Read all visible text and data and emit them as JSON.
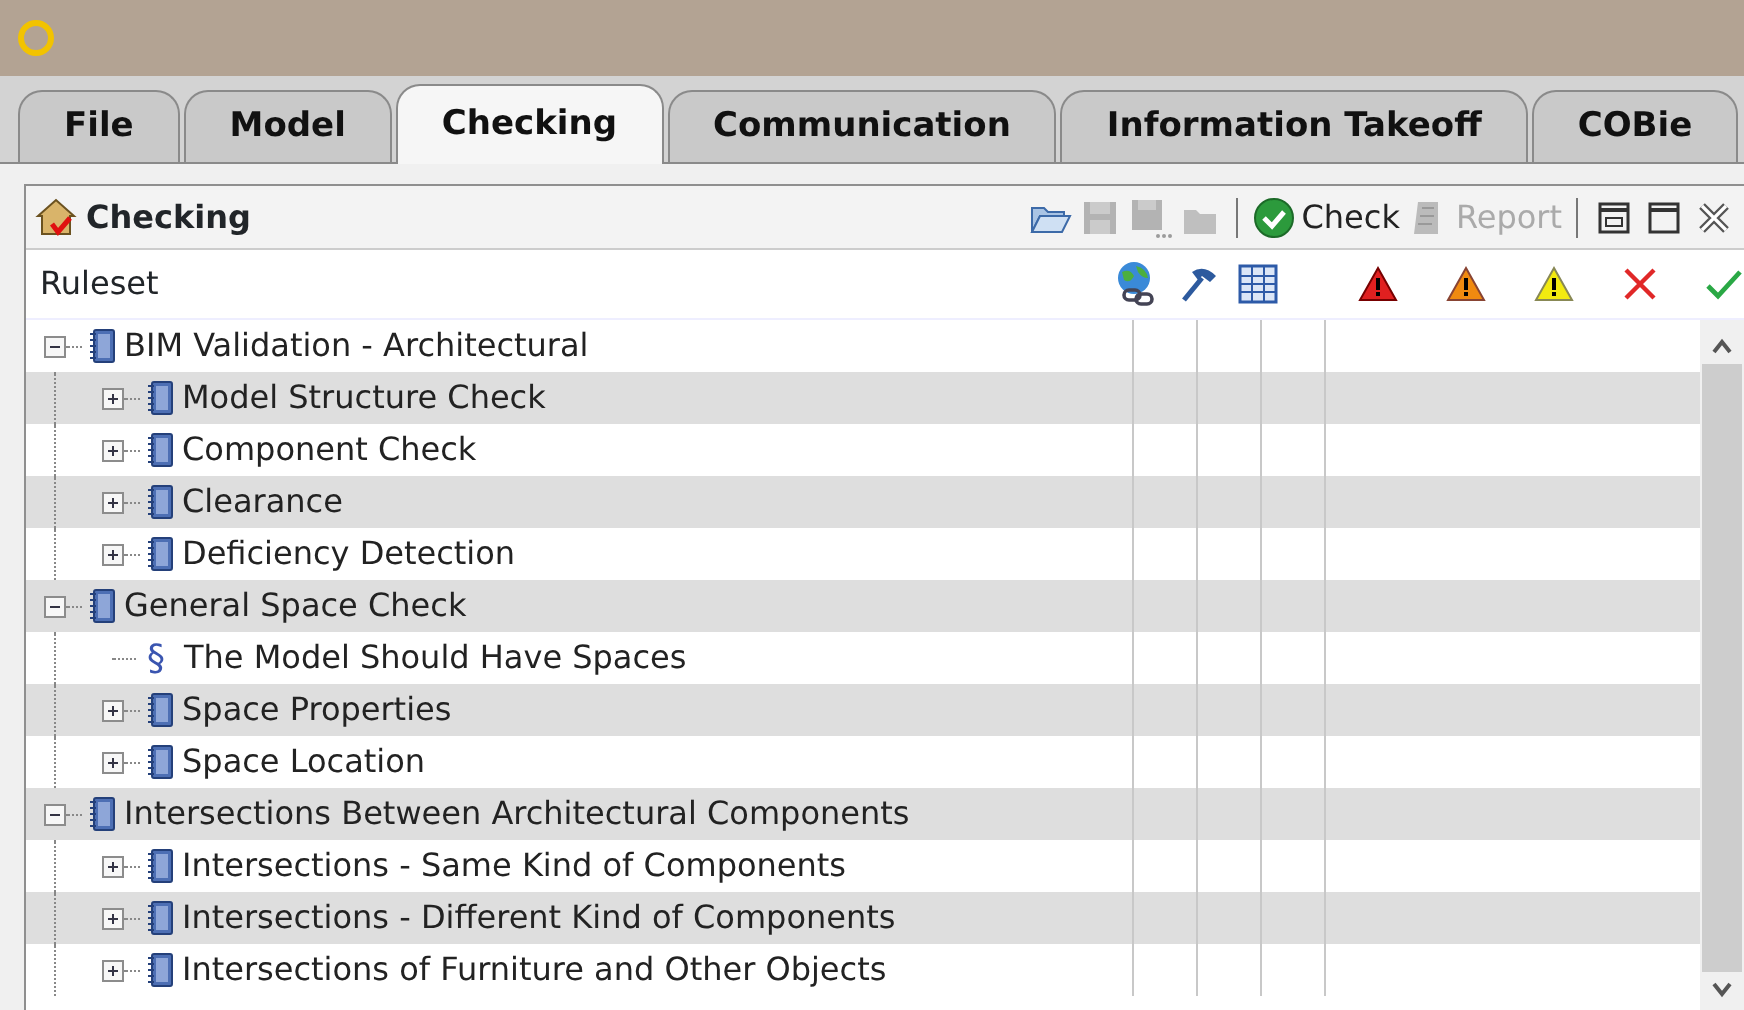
{
  "tabs": [
    {
      "label": "File",
      "selected": false
    },
    {
      "label": "Model",
      "selected": false
    },
    {
      "label": "Checking",
      "selected": true
    },
    {
      "label": "Communication",
      "selected": false
    },
    {
      "label": "Information Takeoff",
      "selected": false
    },
    {
      "label": "COBie",
      "selected": false
    }
  ],
  "panel": {
    "title": "Checking",
    "toolbar": [
      {
        "kind": "open",
        "disabled": false
      },
      {
        "kind": "save",
        "disabled": true
      },
      {
        "kind": "save-as",
        "disabled": true
      },
      {
        "kind": "folder",
        "disabled": true
      },
      {
        "kind": "separator"
      },
      {
        "kind": "check",
        "label": "Check",
        "disabled": false
      },
      {
        "kind": "report",
        "label": "Report",
        "disabled": true
      },
      {
        "kind": "separator"
      },
      {
        "kind": "restore"
      },
      {
        "kind": "maximize"
      },
      {
        "kind": "close"
      }
    ]
  },
  "table": {
    "columns": [
      {
        "label": "Ruleset"
      }
    ],
    "tree": [
      {
        "label": "BIM Validation - Architectural",
        "kind": "ruleset",
        "expanded": true,
        "children": [
          {
            "label": "Model Structure Check",
            "kind": "ruleset",
            "expanded": false
          },
          {
            "label": "Component Check",
            "kind": "ruleset",
            "expanded": false
          },
          {
            "label": "Clearance",
            "kind": "ruleset",
            "expanded": false
          },
          {
            "label": "Deficiency Detection",
            "kind": "ruleset",
            "expanded": false
          }
        ]
      },
      {
        "label": "General Space Check",
        "kind": "ruleset",
        "expanded": true,
        "children": [
          {
            "label": "The Model Should Have Spaces",
            "kind": "rule",
            "glyph": "§"
          },
          {
            "label": "Space Properties",
            "kind": "ruleset",
            "expanded": false
          },
          {
            "label": "Space Location",
            "kind": "ruleset",
            "expanded": false
          }
        ]
      },
      {
        "label": "Intersections Between Architectural Components",
        "kind": "ruleset",
        "expanded": true,
        "children": [
          {
            "label": "Intersections - Same Kind of Components",
            "kind": "ruleset",
            "expanded": false
          },
          {
            "label": "Intersections - Different Kind of Components",
            "kind": "ruleset",
            "expanded": false
          },
          {
            "label": "Intersections of Furniture and Other Objects",
            "kind": "ruleset",
            "expanded": false
          }
        ]
      }
    ]
  }
}
